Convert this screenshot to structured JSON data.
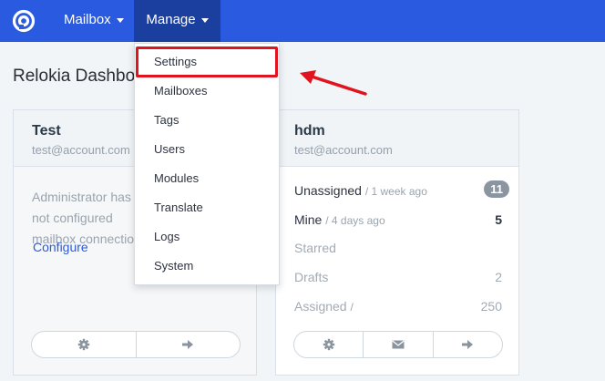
{
  "navbar": {
    "mailbox_label": "Mailbox",
    "manage_label": "Manage",
    "accent": "#2a5ae0"
  },
  "page": {
    "title": "Relokia Dashboard"
  },
  "manage_menu": {
    "items": [
      "Settings",
      "Mailboxes",
      "Tags",
      "Users",
      "Modules",
      "Translate",
      "Logs",
      "System"
    ],
    "highlighted": "Settings"
  },
  "cards": {
    "test": {
      "title": "Test",
      "email": "test@account.com",
      "message": "Administrator has not configured mailbox connection",
      "configure_label": "Configure"
    },
    "hdm": {
      "title": "hdm",
      "email": "test@account.com",
      "stats": [
        {
          "name": "Unassigned",
          "time": "/ 1 week ago",
          "value": "11"
        },
        {
          "name": "Mine",
          "time": "/ 4 days ago",
          "value": "5"
        },
        {
          "name": "Starred",
          "time": "",
          "value": ""
        },
        {
          "name": "Drafts",
          "time": "",
          "value": "2"
        },
        {
          "name": "Assigned",
          "time": "/",
          "value": "250"
        }
      ]
    }
  },
  "icons": [
    "logo-icon",
    "gear-icon",
    "envelope-icon",
    "arrow-right-icon"
  ],
  "annotation_color": "#e0141e"
}
